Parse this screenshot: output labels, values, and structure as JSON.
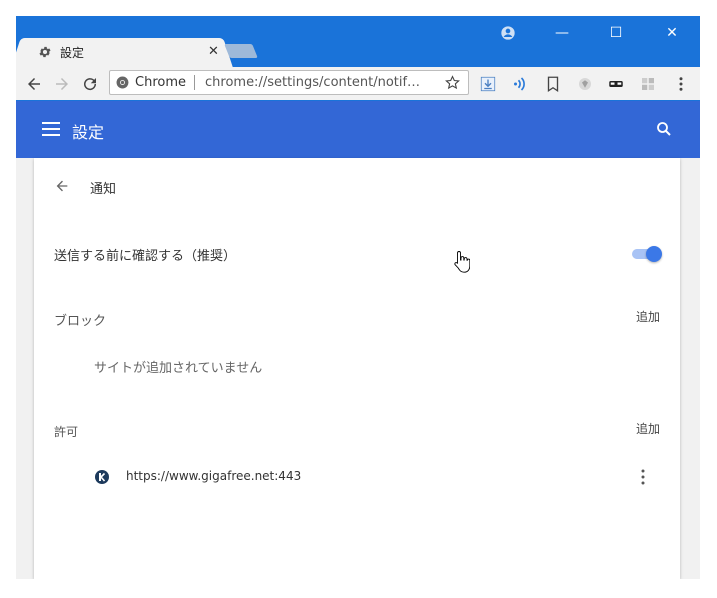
{
  "browser": {
    "tab_title": "設定",
    "tab_close": "✕",
    "window_minimize": "—",
    "window_maximize": "☐",
    "window_close": "✕"
  },
  "omnibox": {
    "site_label": "Chrome",
    "url": "chrome://settings/content/notif…"
  },
  "settings": {
    "header_title": "設定",
    "section_title": "通知",
    "ask_before_sending_label": "送信する前に確認する（推奨）",
    "ask_before_sending_enabled": true,
    "block": {
      "label": "ブロック",
      "add_label": "追加",
      "empty_text": "サイトが追加されていません"
    },
    "allow": {
      "label": "許可",
      "add_label": "追加",
      "sites": [
        {
          "url": "https://www.gigafree.net:443"
        }
      ]
    }
  },
  "colors": {
    "titlebar": "#1a73d9",
    "settings_header": "#3367d6",
    "toggle_on": "#3b78e7"
  },
  "icons": [
    "gear-icon",
    "profile-icon",
    "back-icon",
    "forward-icon",
    "reload-icon",
    "chrome-icon",
    "star-icon",
    "download-icon",
    "extension-icon",
    "bookmark-icon",
    "menu-icon",
    "search-icon",
    "arrow-back-icon",
    "more-vert-icon"
  ]
}
